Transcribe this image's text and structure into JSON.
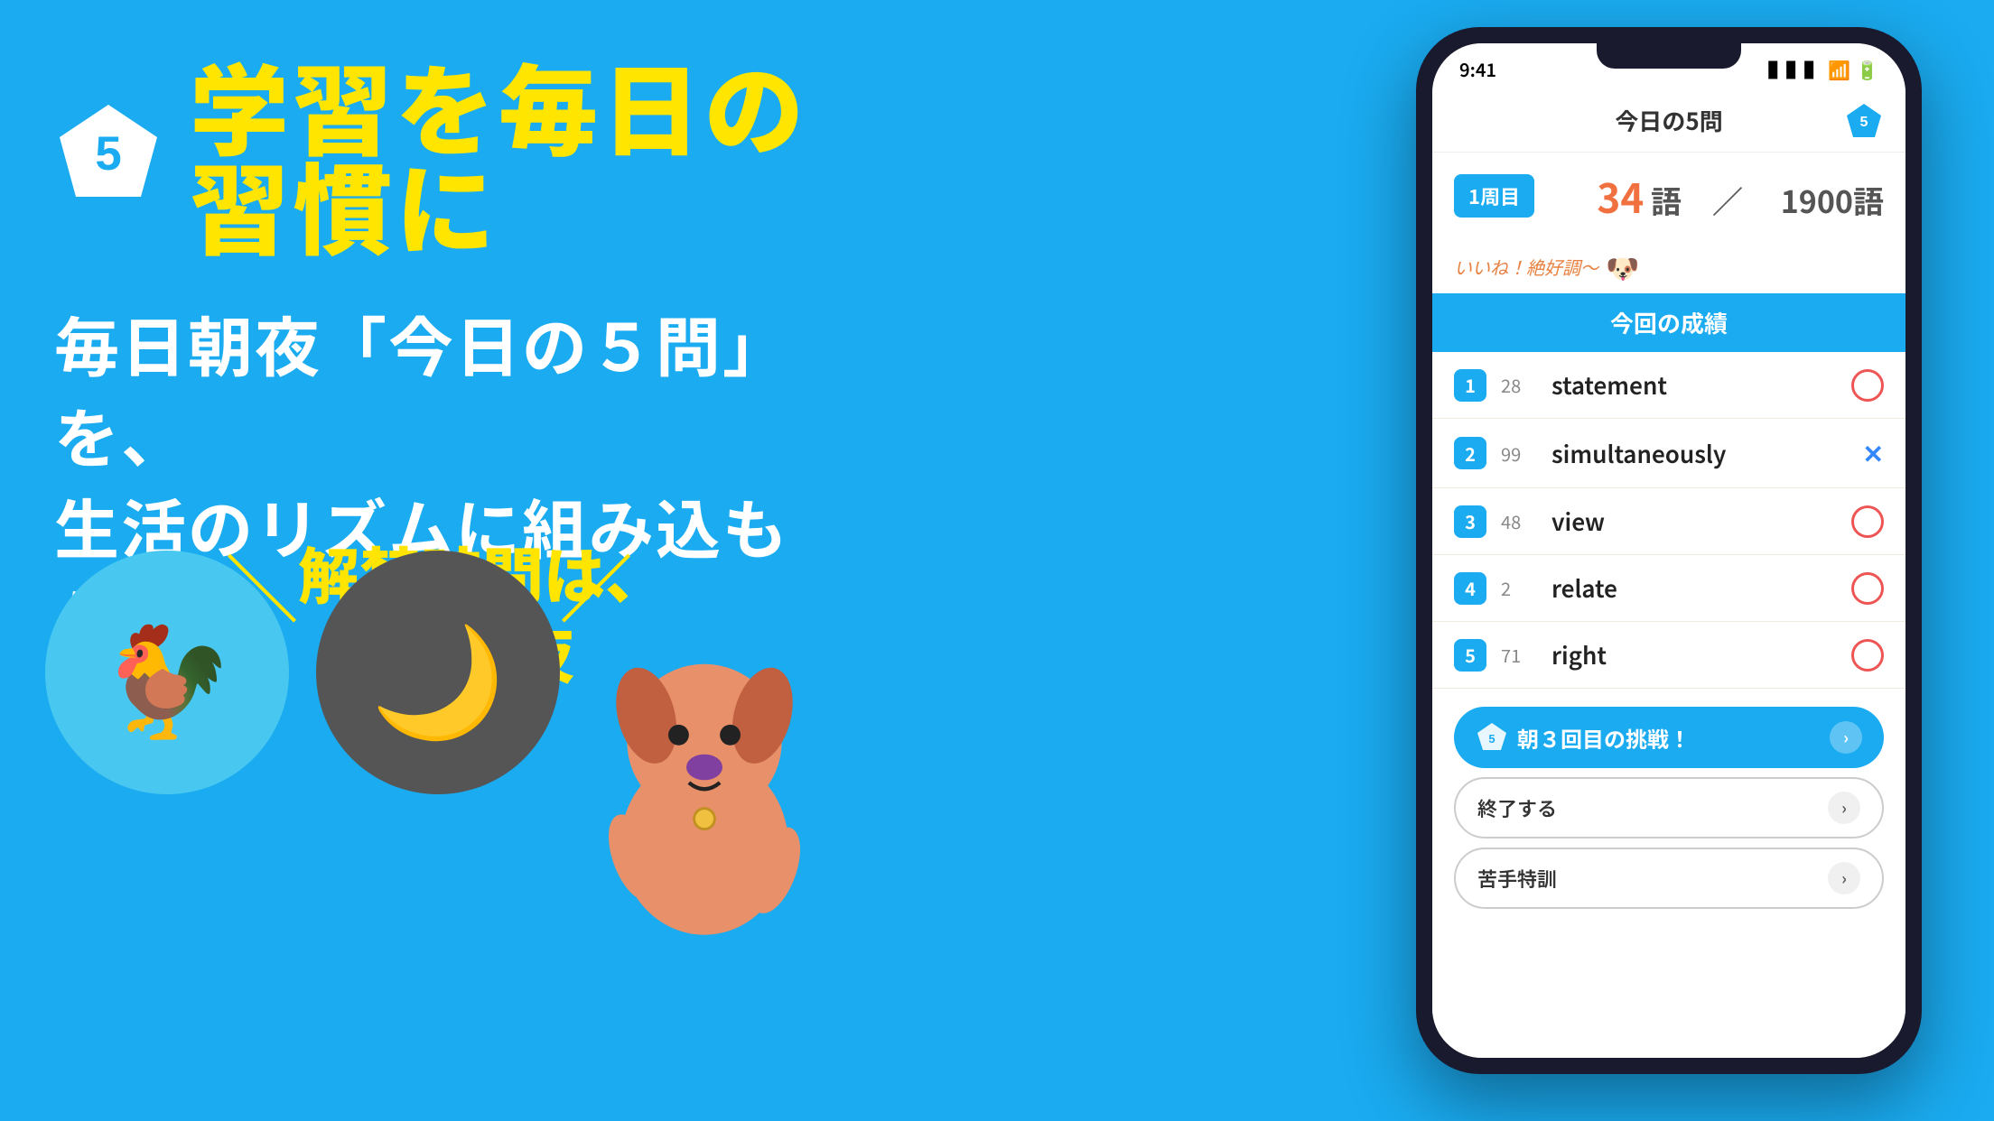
{
  "left": {
    "step_number": "5",
    "main_title": "学習を毎日の習慣に",
    "subtitle_line1": "毎日朝夜「今日の５問」を、",
    "subtitle_line2": "生活のリズムに組み込もう！",
    "unlock_line1": "解禁時間は、",
    "unlock_line2": "朝と夜",
    "rooster_emoji": "🐓",
    "moon_emoji": "🌙"
  },
  "phone": {
    "status": {
      "time": "9:41",
      "battery": "▮▮▮",
      "wifi": "WiFi",
      "signal": "Sig"
    },
    "header": {
      "title": "今日の5問",
      "badge": "5"
    },
    "round": {
      "label": "1周目",
      "current": "34",
      "separator": "語　／",
      "total": "1900語"
    },
    "praise": "いいね！絶好調～",
    "results_title": "今回の成績",
    "words": [
      {
        "num": "1",
        "freq": "28",
        "word": "statement",
        "result": "circle"
      },
      {
        "num": "2",
        "freq": "99",
        "word": "simultaneously",
        "result": "cross"
      },
      {
        "num": "3",
        "freq": "48",
        "word": "view",
        "result": "circle"
      },
      {
        "num": "4",
        "freq": "2",
        "word": "relate",
        "result": "circle"
      },
      {
        "num": "5",
        "freq": "71",
        "word": "right",
        "result": "circle"
      }
    ],
    "challenge_btn": {
      "badge": "5",
      "label": "朝３回目の挑戦！"
    },
    "finish_btn": "終了する",
    "weak_btn": "苦手特訓"
  }
}
